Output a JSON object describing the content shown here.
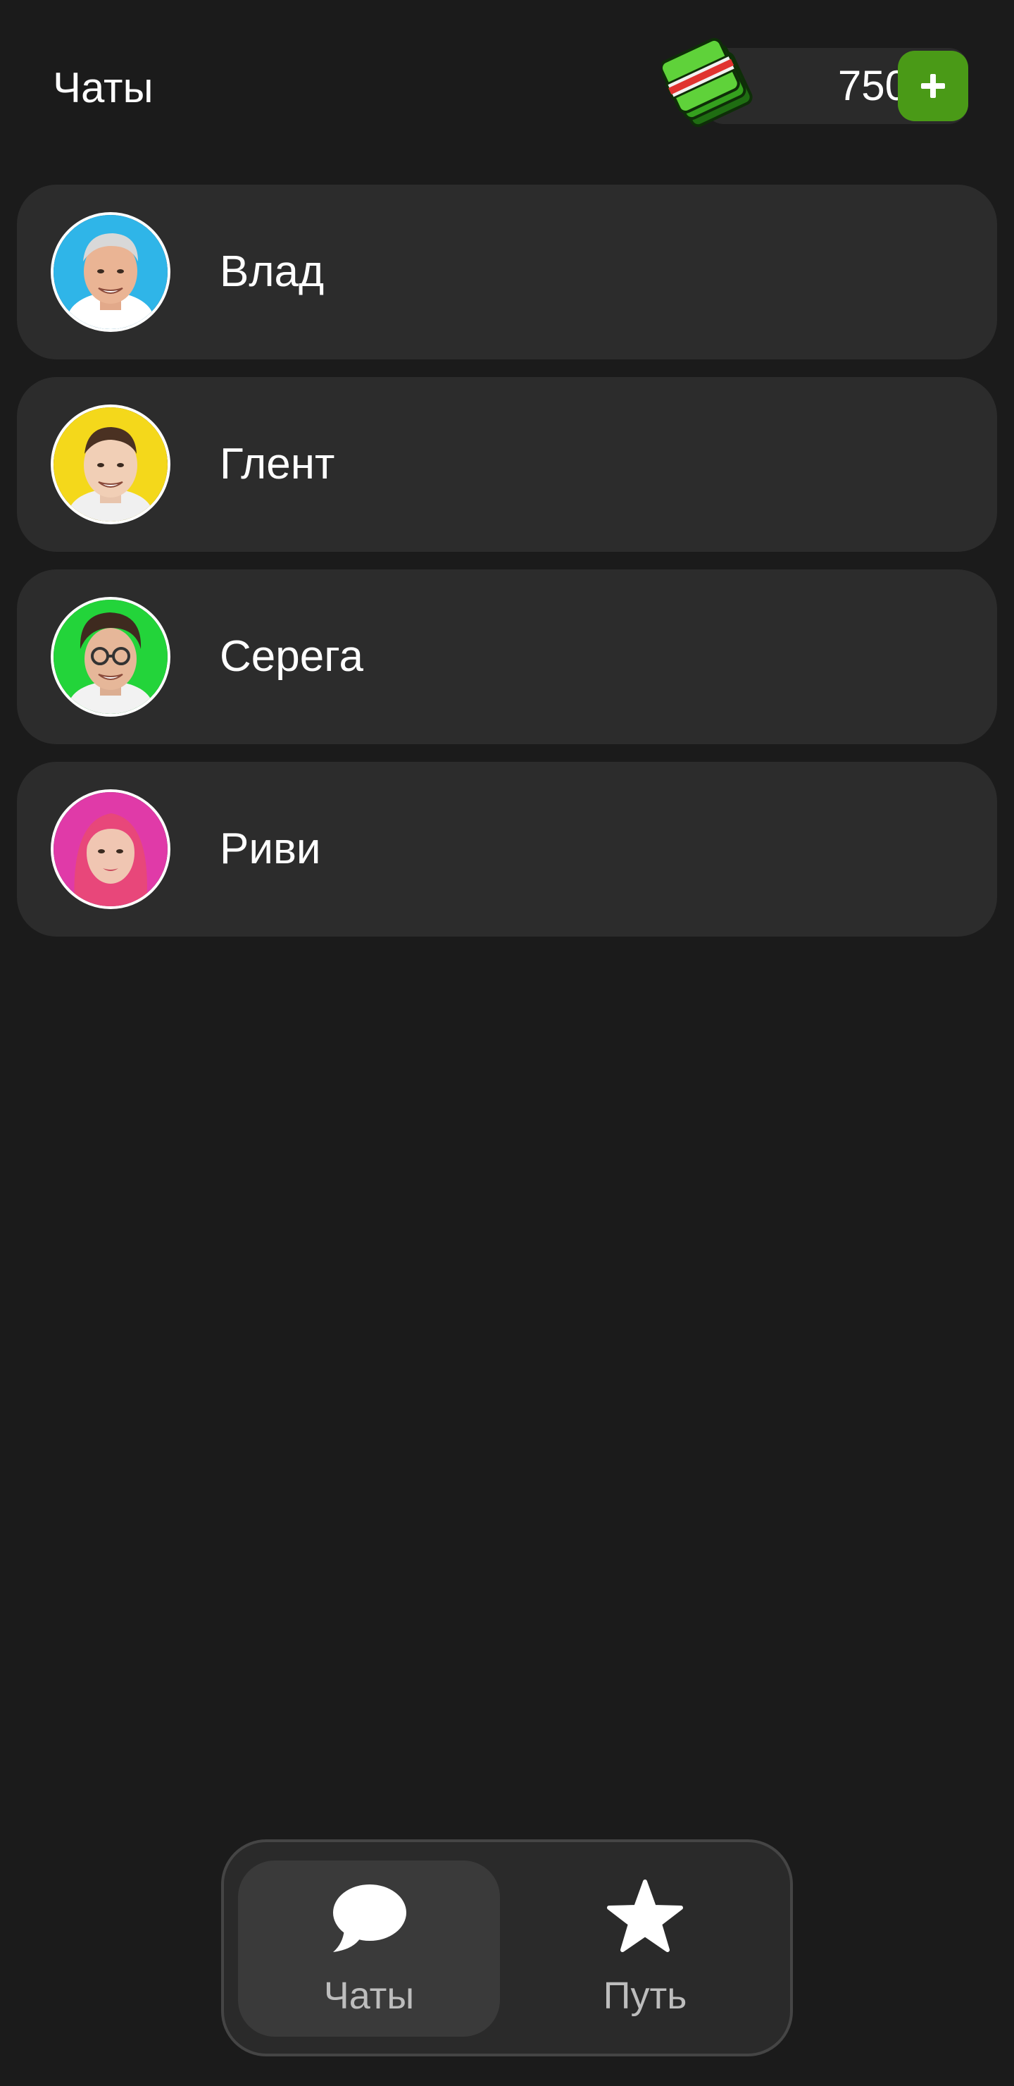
{
  "header": {
    "title": "Чаты",
    "balance": "750",
    "add_label": "+"
  },
  "chats": [
    {
      "name": "Влад",
      "avatar_bg": "#2fb5e8"
    },
    {
      "name": "Глент",
      "avatar_bg": "#f4d81b"
    },
    {
      "name": "Серега",
      "avatar_bg": "#23d43a"
    },
    {
      "name": "Риви",
      "avatar_bg": "#e03aa8"
    }
  ],
  "nav": {
    "tabs": [
      {
        "label": "Чаты",
        "icon": "chat-bubble-icon",
        "active": true
      },
      {
        "label": "Путь",
        "icon": "star-icon",
        "active": false
      }
    ]
  },
  "colors": {
    "background": "#1b1b1b",
    "card": "#2c2c2c",
    "accent_green": "#4a9a17"
  }
}
